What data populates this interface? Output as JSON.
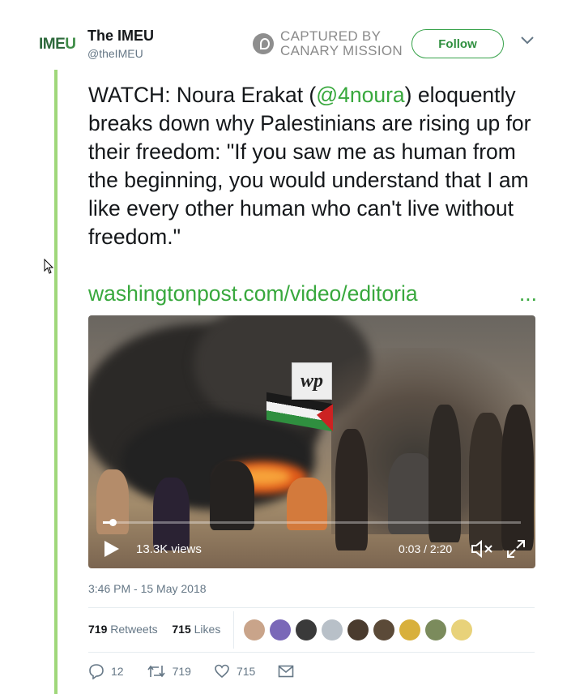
{
  "header": {
    "avatar_text_a": "IME",
    "avatar_text_b": "U",
    "display_name": "The IMEU",
    "handle": "@theIMEU",
    "captured_label_line1": "CAPTURED BY",
    "captured_label_line2": "CANARY MISSION",
    "follow_label": "Follow"
  },
  "tweet": {
    "text_prefix": "WATCH: Noura Erakat (",
    "mention": "@4noura",
    "text_suffix": ") eloquently breaks down why Palestinians are rising up for their freedom: \"If you saw me as human from the beginning, you would understand that I am like every other human who can't live without freedom.\"",
    "link_text": "washingtonpost.com/video/editoria",
    "link_ellipsis": "..."
  },
  "video": {
    "badge": "wp",
    "views": "13.3K views",
    "time": "0:03 / 2:20",
    "progress_fraction": 0.023
  },
  "meta": {
    "timestamp": "3:46 PM - 15 May 2018"
  },
  "stats": {
    "retweets_count": "719",
    "retweets_label": "Retweets",
    "likes_count": "715",
    "likes_label": "Likes",
    "avatar_colors": [
      "#c9a48a",
      "#7a68b8",
      "#3a3a3a",
      "#b8c0c8",
      "#4a3b2e",
      "#5b4a38",
      "#d8b03c",
      "#7b8b5c",
      "#e8d27a"
    ]
  },
  "actions": {
    "replies": "12",
    "retweets": "719",
    "likes": "715"
  },
  "colors": {
    "accent_green": "#38a83d",
    "rail_green": "#9fd77a",
    "muted": "#657786"
  }
}
